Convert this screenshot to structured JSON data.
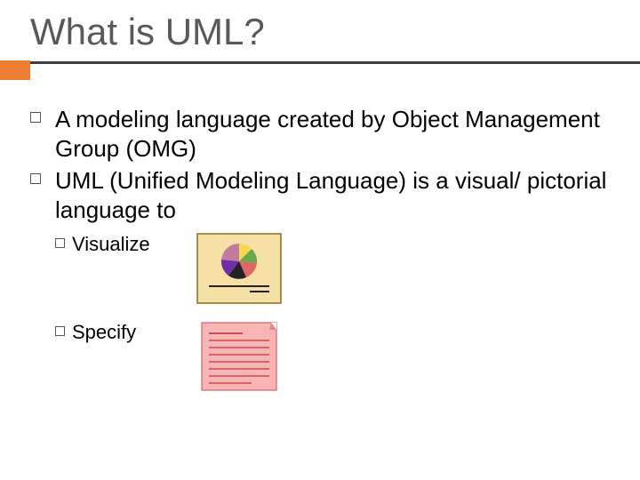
{
  "title": "What is UML?",
  "bullets": [
    "A modeling language created by Object Management Group (OMG)",
    "UML (Unified Modeling Language) is a visual/ pictorial language to"
  ],
  "subitems": [
    {
      "label": "Visualize"
    },
    {
      "label": "Specify"
    }
  ]
}
